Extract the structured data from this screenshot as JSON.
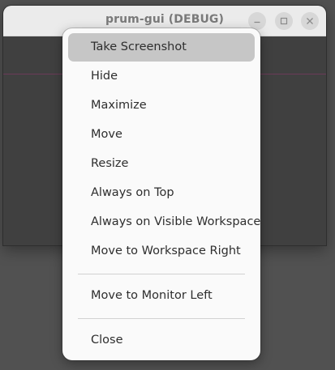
{
  "window": {
    "title": "prum-gui (DEBUG)"
  },
  "menu": {
    "items": [
      {
        "label": "Take Screenshot",
        "highlighted": true
      },
      {
        "label": "Hide"
      },
      {
        "label": "Maximize"
      },
      {
        "label": "Move"
      },
      {
        "label": "Resize"
      },
      {
        "label": "Always on Top"
      },
      {
        "label": "Always on Visible Workspace"
      },
      {
        "label": "Move to Workspace Right"
      },
      {
        "label": "Move to Monitor Left"
      },
      {
        "label": "Close"
      }
    ]
  },
  "colors": {
    "desktop_background": "#515151",
    "headerbar": "#ebebeb",
    "menu_background": "#fafafa",
    "menu_highlight": "#c6c6c6",
    "accent_line": "#6b3a58"
  }
}
